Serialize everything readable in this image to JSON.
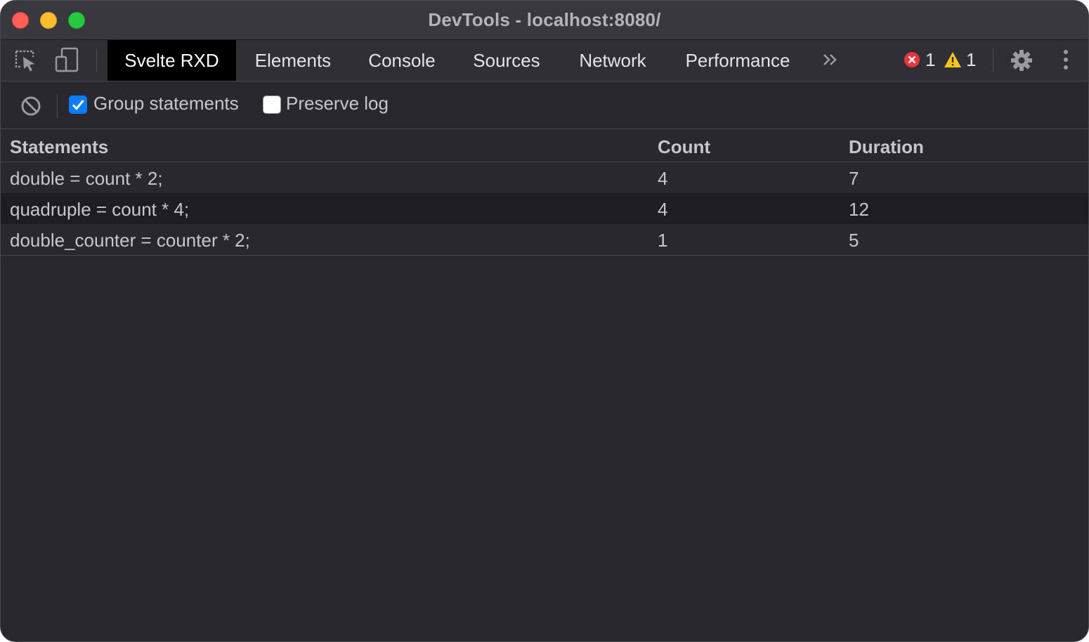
{
  "window": {
    "title": "DevTools - localhost:8080/"
  },
  "tabbar": {
    "tabs": [
      {
        "label": "Svelte RXD",
        "active": true
      },
      {
        "label": "Elements",
        "active": false
      },
      {
        "label": "Console",
        "active": false
      },
      {
        "label": "Sources",
        "active": false
      },
      {
        "label": "Network",
        "active": false
      },
      {
        "label": "Performance",
        "active": false
      }
    ],
    "errors_count": "1",
    "warnings_count": "1"
  },
  "toolbar": {
    "group_statements": {
      "label": "Group statements",
      "checked": true
    },
    "preserve_log": {
      "label": "Preserve log",
      "checked": false
    }
  },
  "table": {
    "headers": {
      "statements": "Statements",
      "count": "Count",
      "duration": "Duration"
    },
    "rows": [
      {
        "statement": "double = count * 2;",
        "count": "4",
        "duration": "7"
      },
      {
        "statement": "quadruple = count * 4;",
        "count": "4",
        "duration": "12"
      },
      {
        "statement": "double_counter = counter * 2;",
        "count": "1",
        "duration": "5"
      }
    ]
  },
  "colors": {
    "background": "#28282e",
    "titlebar": "#38383d",
    "active_tab": "#000000",
    "checkbox_accent": "#0a7cff",
    "error": "#e8363d",
    "warning": "#f5c518"
  }
}
